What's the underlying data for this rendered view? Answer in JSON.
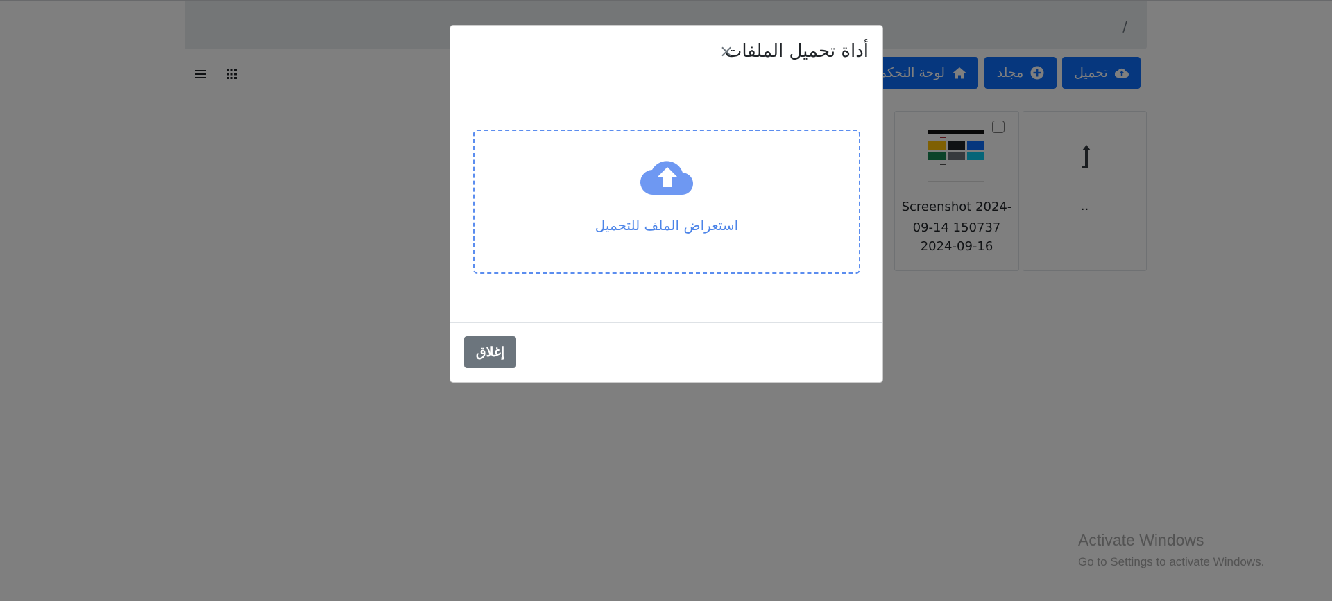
{
  "breadcrumb": {
    "separator": "/"
  },
  "toolbar": {
    "upload_label": "تحميل",
    "folder_label": "مجلد",
    "dashboard_label": "لوحة التحكم",
    "primary_color": "#0d6efd"
  },
  "files": {
    "parent_label": "..",
    "items": [
      {
        "name": "Screenshot 2024-09-14 150737",
        "date": "2024-09-16"
      }
    ]
  },
  "modal": {
    "title": "أداة تحميل الملفات",
    "close_symbol": "×",
    "dropzone_label": "استعراض الملف للتحميل",
    "close_button_label": "إغلاق",
    "accent_color": "#5b8def"
  },
  "watermark": {
    "title": "Activate Windows",
    "subtitle": "Go to Settings to activate Windows."
  },
  "icons": {
    "upload_button": "cloud-upload-icon",
    "folder_button": "plus-circle-icon",
    "dashboard_button": "home-icon",
    "list_view": "list-icon",
    "grid_view": "grid-icon",
    "parent_dir": "level-up-arrow-icon",
    "dropzone": "cloud-upload-icon",
    "modal_close": "close-icon"
  }
}
